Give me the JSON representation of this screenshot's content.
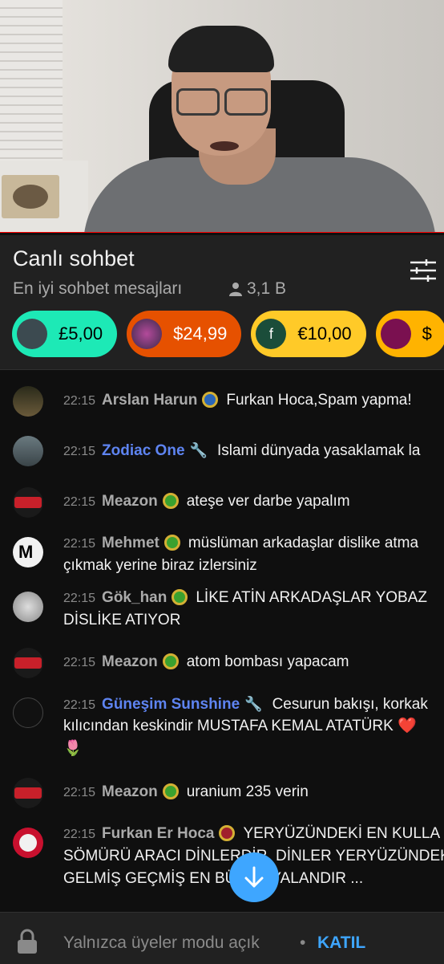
{
  "video": {
    "description_icon": "video-frame"
  },
  "chat_header": {
    "title": "Canlı sohbet",
    "subtitle": "En iyi sohbet mesajları",
    "viewer_count": "3,1 B"
  },
  "tickers": [
    {
      "amount": "£5,00",
      "color": "#1de9b6",
      "text_color": "#000000"
    },
    {
      "amount": "$24,99",
      "color": "#e65100",
      "text_color": "#ffffff"
    },
    {
      "amount": "€10,00",
      "color": "#ffca28",
      "text_color": "#000000"
    },
    {
      "amount": "$",
      "color": "#ffb300",
      "text_color": "#000000"
    }
  ],
  "messages": [
    {
      "time": "22:15",
      "author": "Arslan Harun",
      "badge": "member",
      "text": "Furkan Hoca,Spam yapma!"
    },
    {
      "time": "22:15",
      "author": "Zodiac One",
      "badge": "moderator",
      "text": "Islami dünyada yasaklamak la"
    },
    {
      "time": "22:15",
      "author": "Meazon",
      "badge": "member",
      "text": "ateşe ver darbe yapalım"
    },
    {
      "time": "22:15",
      "author": "Mehmet",
      "badge": "member",
      "text": "müslüman arkadaşlar dislike atma",
      "text2": "çıkmak yerine biraz izlersiniz"
    },
    {
      "time": "22:15",
      "author": "Gök_han",
      "badge": "member",
      "text": "LİKE ATİN ARKADAŞLAR YOBAZ",
      "text2": "DİSLİKE ATIYOR"
    },
    {
      "time": "22:15",
      "author": "Meazon",
      "badge": "member",
      "text": "atom bombası yapacam"
    },
    {
      "time": "22:15",
      "author": "Güneşim Sunshine",
      "badge": "moderator",
      "text": "Cesurun bakışı, korkak",
      "text2": "kılıcından keskindir MUSTAFA KEMAL ATATÜRK",
      "emoji_heart": "❤️",
      "emoji_tulip": "🌷"
    },
    {
      "time": "22:15",
      "author": "Meazon",
      "badge": "member",
      "text": "uranium 235 verin"
    },
    {
      "time": "22:15",
      "author": "Furkan Er Hoca",
      "badge": "member",
      "text": "YERYÜZÜNDEKİ EN KULLA",
      "text2": "SÖMÜRÜ ARACI DİNLERDİR. DİNLER YERYÜZÜNDEK",
      "text3": "GELMİŞ GEÇMİŞ EN BÜYÜK YALANDIR ..."
    }
  ],
  "footer": {
    "members_only": "Yalnızca üyeler modu açık",
    "separator": "•",
    "join_label": "KATIL"
  },
  "colors": {
    "accent": "#3ea6ff",
    "moderator": "#5e84f1",
    "background": "#0f0f0f",
    "header_bg": "#212121"
  }
}
